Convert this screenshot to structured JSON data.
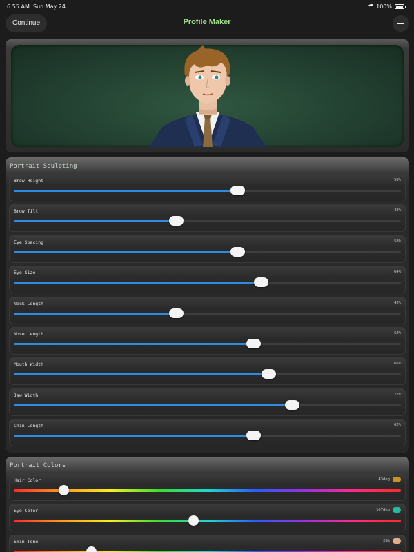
{
  "status_bar": {
    "time": "6:55 AM",
    "date": "Sun May 24",
    "battery": "100%"
  },
  "navbar": {
    "continue_label": "Continue",
    "title": "Profile Maker",
    "menu_icon": "hamburger-menu-icon"
  },
  "portrait": {
    "description_icon": "avatar-portrait"
  },
  "sculpting": {
    "title": "Portrait Sculpting",
    "sliders": [
      {
        "label": "Brow Height",
        "value_text": "58%",
        "value": 0.58
      },
      {
        "label": "Brow Tilt",
        "value_text": "42%",
        "value": 0.42
      },
      {
        "label": "Eye Spacing",
        "value_text": "58%",
        "value": 0.58
      },
      {
        "label": "Eye Size",
        "value_text": "64%",
        "value": 0.64
      },
      {
        "label": "Neck Length",
        "value_text": "42%",
        "value": 0.42
      },
      {
        "label": "Nose Length",
        "value_text": "62%",
        "value": 0.62
      },
      {
        "label": "Mouth Width",
        "value_text": "66%",
        "value": 0.66
      },
      {
        "label": "Jaw Width",
        "value_text": "72%",
        "value": 0.72
      },
      {
        "label": "Chin Length",
        "value_text": "62%",
        "value": 0.62
      }
    ]
  },
  "colors": {
    "title": "Portrait Colors",
    "sliders": [
      {
        "label": "Hair Color",
        "value_text": "43deg",
        "value": 0.13,
        "swatch": "#c8932a"
      },
      {
        "label": "Eye Color",
        "value_text": "167deg",
        "value": 0.465,
        "swatch": "#2ab6a0"
      },
      {
        "label": "Skin Tone",
        "value_text": "28%",
        "value": 0.2,
        "swatch": "#e3ad8a"
      }
    ]
  },
  "theme": {
    "accent": "#2f8ae0",
    "title_green": "#9ee08a"
  }
}
